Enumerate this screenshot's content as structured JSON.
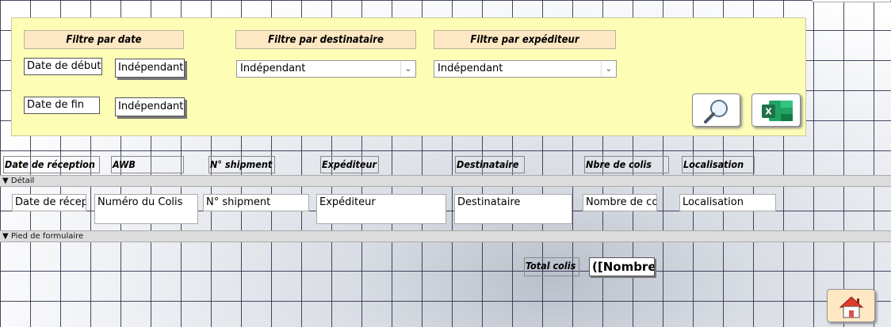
{
  "filters": {
    "date_header": "Filtre par date",
    "start_label": "Date de début",
    "start_value": "Indépendant",
    "end_label": "Date de fin",
    "end_value": "Indépendant",
    "recipient_header": "Filtre par destinataire",
    "recipient_value": "Indépendant",
    "sender_header": "Filtre par expéditeur",
    "sender_value": "Indépendant",
    "search_icon": "magnifier-icon",
    "excel_icon": "excel-icon",
    "excel_letter": "X"
  },
  "columns": [
    "Date de réception",
    "AWB",
    "N° shipment",
    "Expéditeur",
    "Destinataire",
    "Nbre de colis",
    "Localisation"
  ],
  "detail": {
    "section_label": "Détail",
    "fields": [
      "Date de récep",
      "Numéro du Colis",
      "N° shipment",
      "Expéditeur",
      "Destinataire",
      "Nombre de co",
      "Localisation"
    ]
  },
  "footer": {
    "section_label": "Pied de formulaire",
    "total_label": "Total colis",
    "total_value": "([Nombre",
    "home_icon": "home-icon"
  },
  "colors": {
    "panel": "#fdfdb6",
    "header_fill": "#fde8c3",
    "excel_green": "#1e7145"
  }
}
